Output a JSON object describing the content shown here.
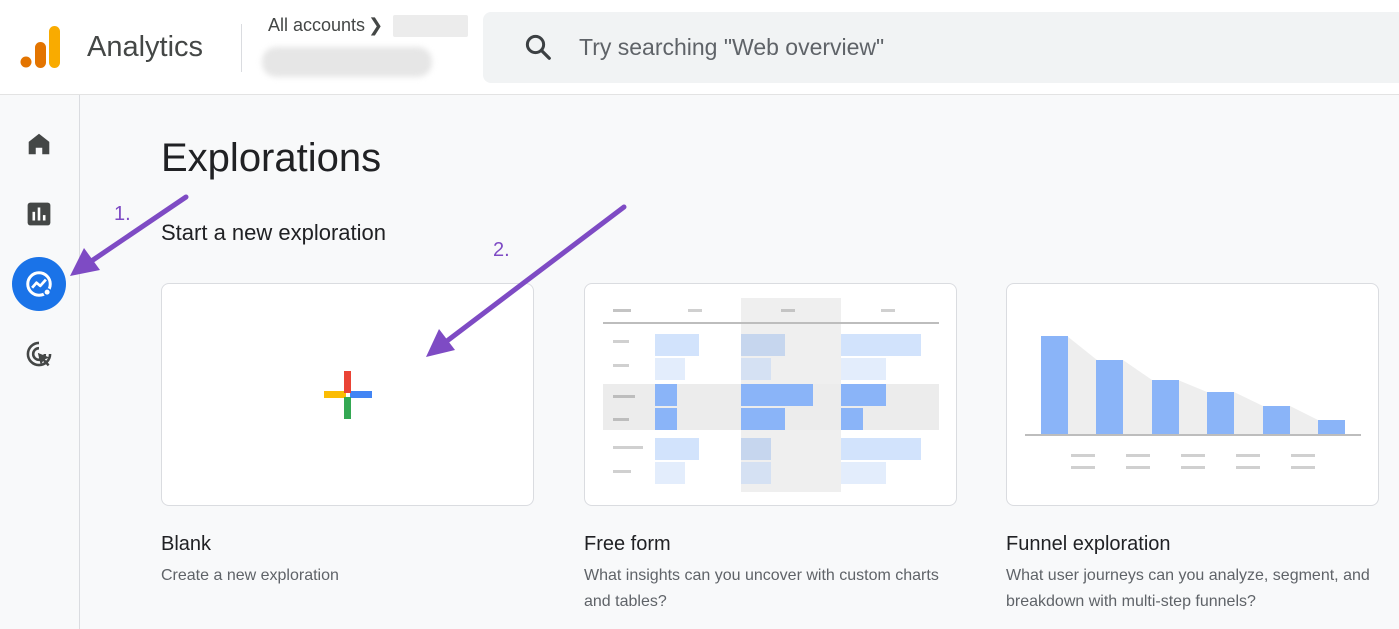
{
  "header": {
    "app_name": "Analytics",
    "account_link": "All accounts",
    "search_placeholder": "Try searching \"Web overview\""
  },
  "sidebar": {
    "items": [
      {
        "name": "Home",
        "icon": "home-icon"
      },
      {
        "name": "Reports",
        "icon": "reports-icon"
      },
      {
        "name": "Explore",
        "icon": "explore-icon",
        "active": true
      },
      {
        "name": "Advertising",
        "icon": "advertising-icon"
      }
    ]
  },
  "main": {
    "title": "Explorations",
    "section_title": "Start a new exploration",
    "templates": [
      {
        "title": "Blank",
        "description": "Create a new exploration"
      },
      {
        "title": "Free form",
        "description": "What insights can you uncover with custom charts and tables?"
      },
      {
        "title": "Funnel exploration",
        "description": "What user journeys can you analyze, segment, and breakdown with multi-step funnels?"
      }
    ]
  },
  "annotations": {
    "step1": "1.",
    "step2": "2."
  },
  "colors": {
    "accent": "#1a73e8",
    "annotation": "#7e4bc4",
    "bar": "#8ab4f8",
    "bar_light": "#d2e3fc"
  }
}
